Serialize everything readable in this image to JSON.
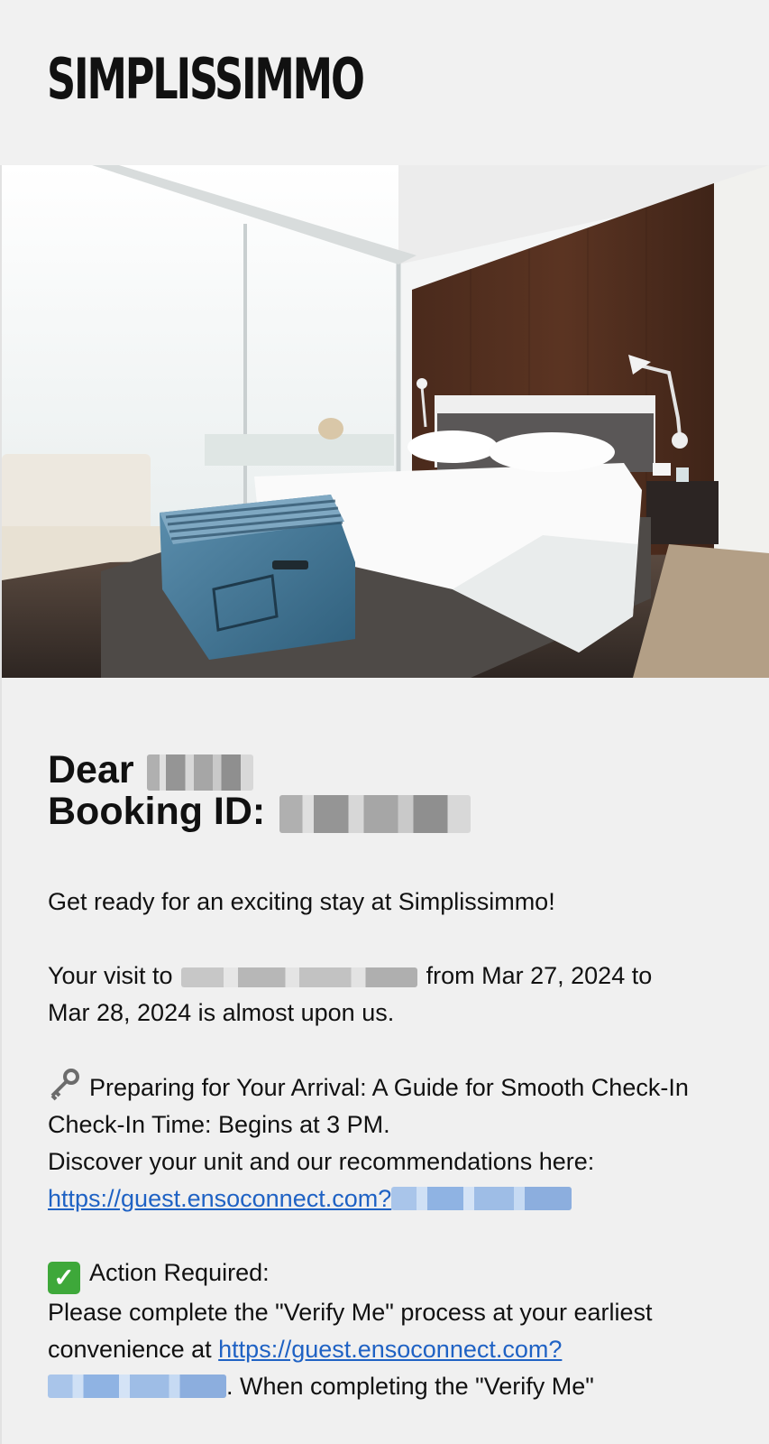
{
  "brand": {
    "logo_text": "SIMPLISSIMMO"
  },
  "hero": {
    "image": "hotel-bedroom-with-suitcase"
  },
  "greeting": {
    "dear_label": "Dear",
    "name_redacted": true,
    "booking_label": "Booking ID:",
    "booking_redacted": true
  },
  "intro": {
    "line": "Get ready for an exciting stay at Simplissimmo!"
  },
  "visit": {
    "prefix": "Your visit to",
    "middle": "from Mar 27, 2024 to",
    "second_line": "Mar 28, 2024 is almost upon us."
  },
  "arrival": {
    "icon": "key-icon",
    "heading": "Preparing for Your Arrival: A Guide for Smooth Check-In",
    "checkin": "Check-In Time: Begins at 3 PM.",
    "discover": "Discover your unit and our recommendations here:",
    "link_text": "https://guest.ensoconnect.com?"
  },
  "action": {
    "icon": "check-mark-icon",
    "heading": "Action Required:",
    "line1": "Please complete the \"Verify Me\" process at your earliest",
    "line2_prefix": "convenience at",
    "link_text": "https://guest.ensoconnect.com?",
    "line3_suffix": ". When completing the \"Verify Me\""
  },
  "colors": {
    "background": "#f0f0f0",
    "link": "#1f62c4",
    "check_green": "#3ea83a"
  }
}
